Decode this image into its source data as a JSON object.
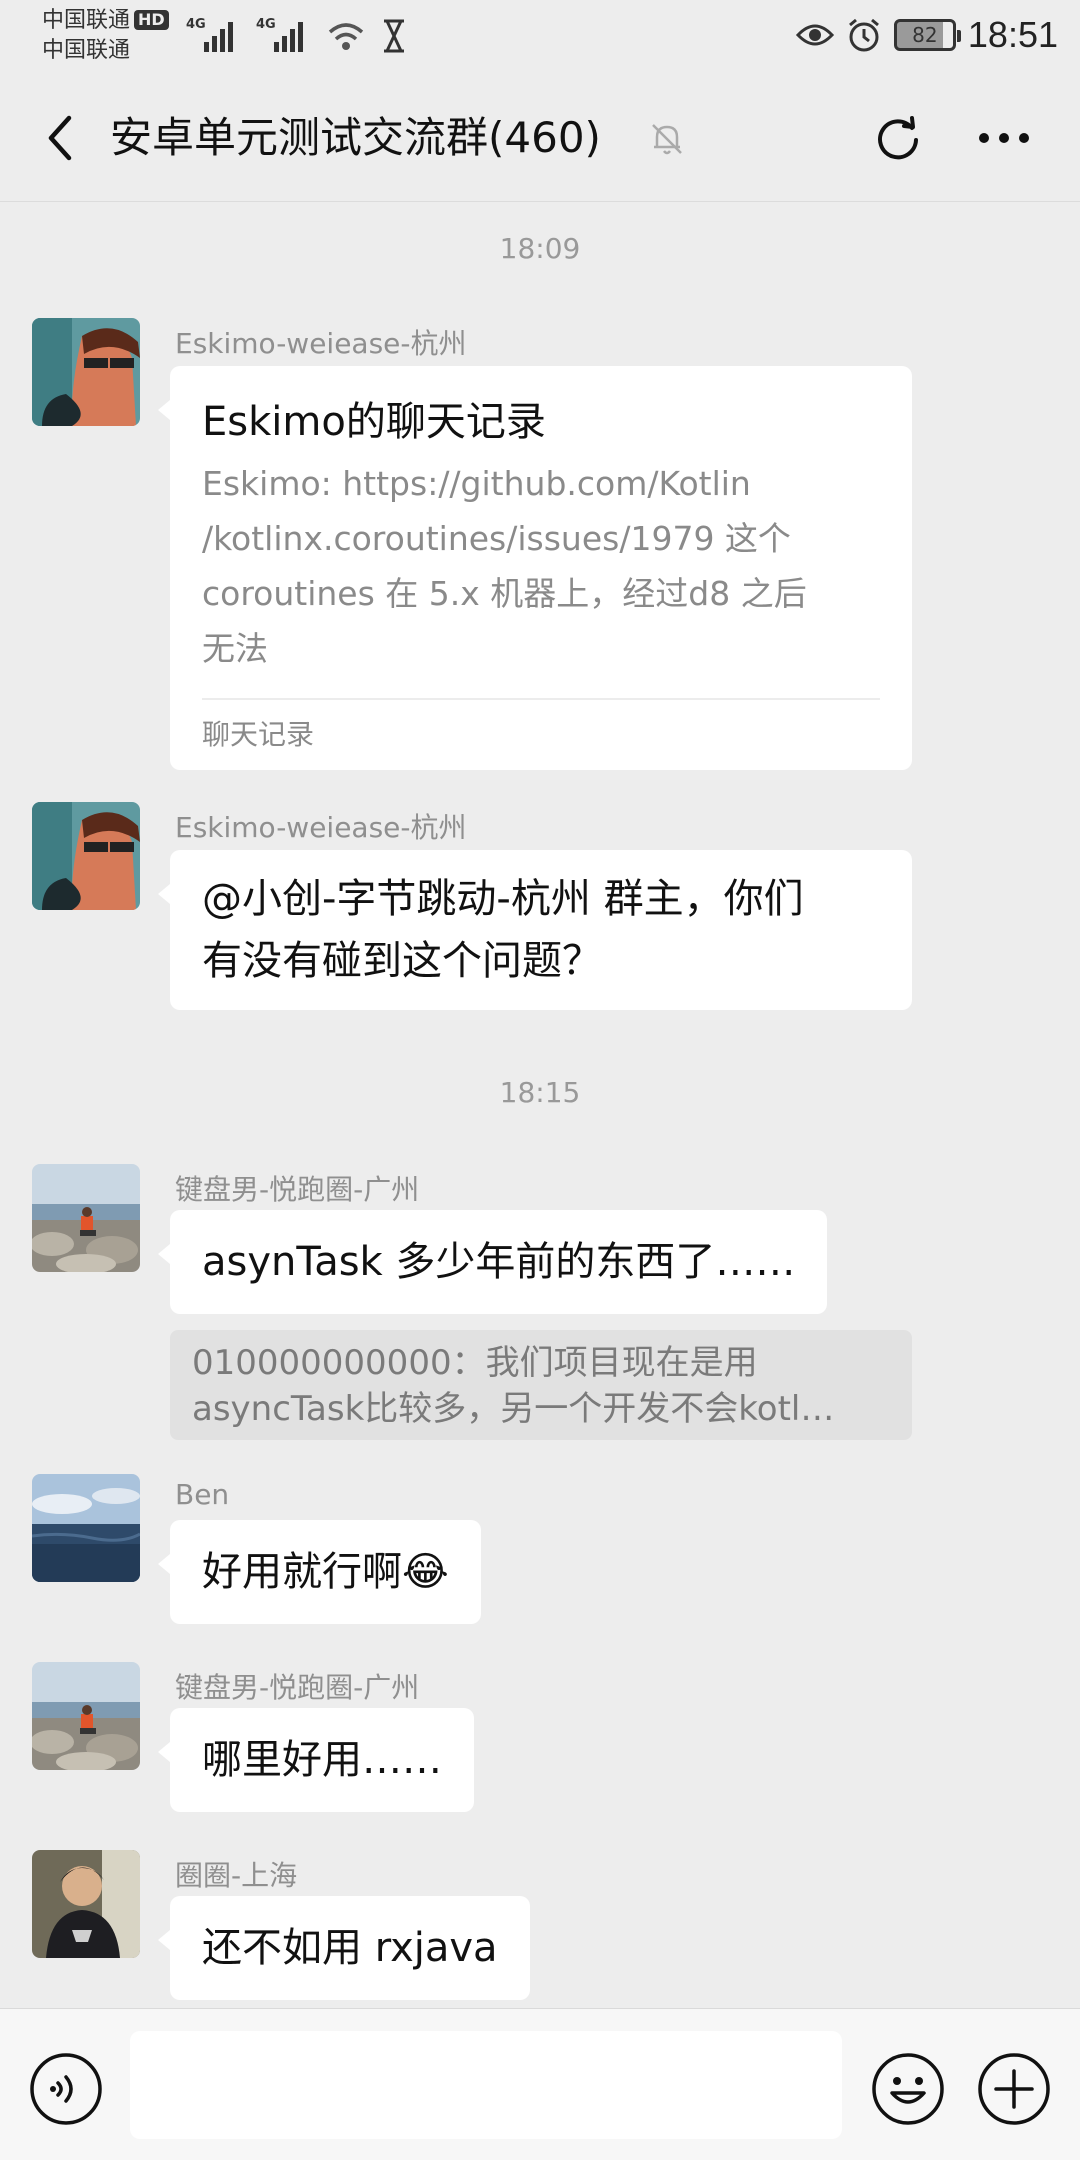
{
  "status_bar": {
    "carrier_1": "中国联通",
    "carrier_2": "中国联通",
    "hd": "HD",
    "network_1": "4G",
    "network_2": "4G",
    "battery": "82",
    "time": "18:51"
  },
  "header": {
    "title": "安卓单元测试交流群(460)"
  },
  "messages": {
    "time_1": "18:09",
    "time_2": "18:15",
    "m1": {
      "sender": "Eskimo-weiease-杭州",
      "record_title": "Eskimo的聊天记录",
      "record_lines": [
        "Eskimo: https://github.com/Kotlin",
        "/kotlinx.coroutines/issues/1979  这个",
        "coroutines 在 5.x 机器上，经过d8 之后",
        "无法"
      ],
      "record_footer": "聊天记录"
    },
    "m2": {
      "sender": "Eskimo-weiease-杭州",
      "lines": [
        "@小创-字节跳动-杭州  群主，你们",
        "有没有碰到这个问题？"
      ]
    },
    "m3": {
      "sender": "键盘男-悦跑圈-广州",
      "text": "asynTask 多少年前的东西了……",
      "quote_lines": [
        "010000000000：我们项目现在是用",
        "asyncTask比较多，另一个开发不会kotl…"
      ]
    },
    "m4": {
      "sender": "Ben",
      "text": "好用就行啊😂"
    },
    "m5": {
      "sender": "键盘男-悦跑圈-广州",
      "text": "哪里好用……"
    },
    "m6": {
      "sender": "圈圈-上海",
      "text": "还不如用 rxjava"
    }
  },
  "input_bar": {
    "value": ""
  },
  "icons": {
    "back": "back-arrow-icon",
    "mute": "bell-muted-icon",
    "refresh": "refresh-icon",
    "more": "more-icon",
    "voice": "voice-icon",
    "emoji": "emoji-icon",
    "plus": "plus-icon"
  },
  "colors": {
    "background": "#ededed",
    "bubble": "#ffffff",
    "quote": "#e1e1e1",
    "sender": "#8f8f8f"
  }
}
